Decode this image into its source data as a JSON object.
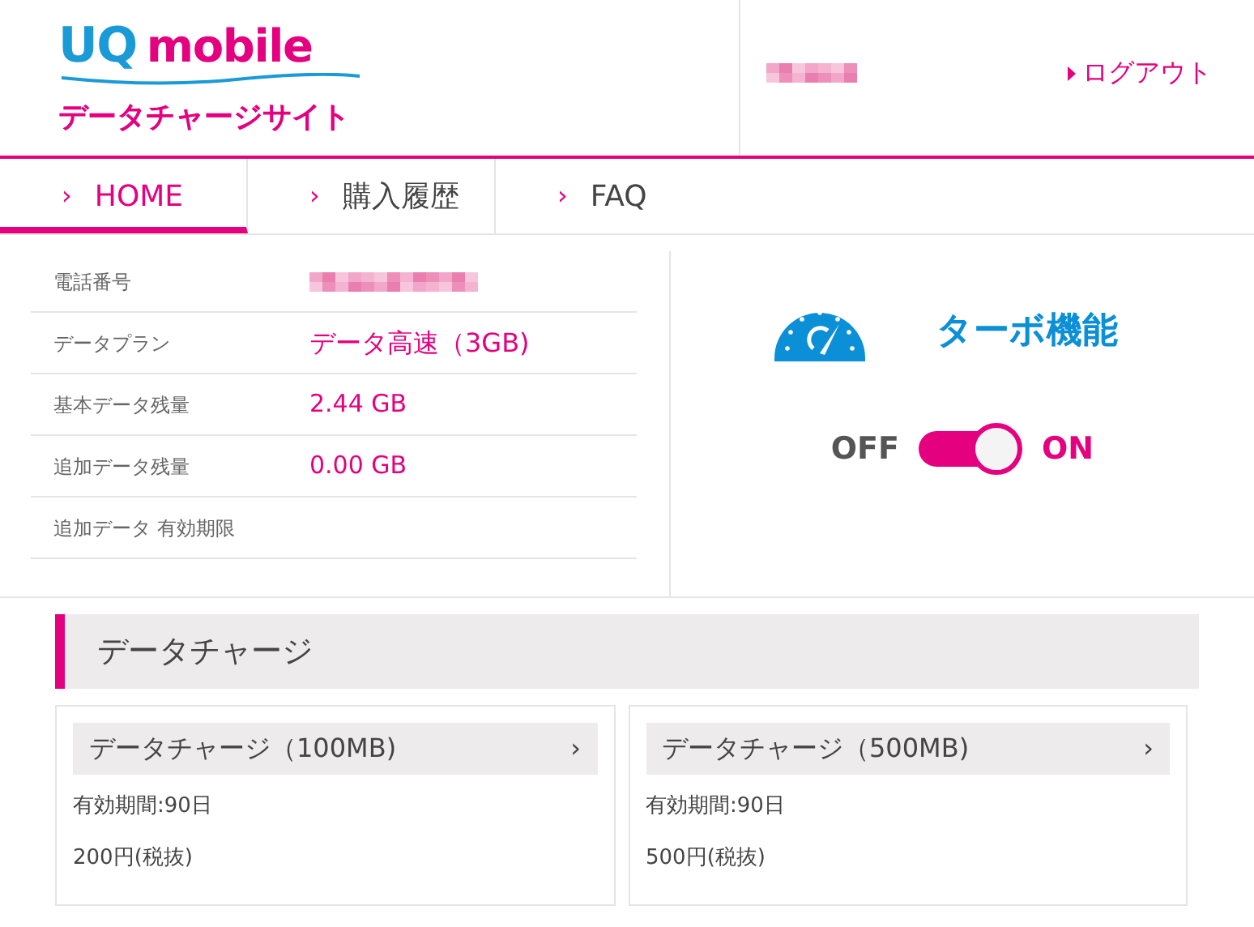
{
  "header": {
    "logo_mark": "UQ",
    "logo_text": "mobile",
    "site_name": "データチャージサイト",
    "logout": "ログアウト"
  },
  "tabs": [
    {
      "arrow": "›",
      "label": "HOME",
      "selected": true
    },
    {
      "arrow": "›",
      "label": "購入履歴",
      "selected": false
    },
    {
      "arrow": "›",
      "label": "FAQ",
      "selected": false
    }
  ],
  "info": [
    {
      "label": "電話番号",
      "kind": "redacted"
    },
    {
      "label": "データプラン",
      "value": "データ高速（3GB)",
      "kind": "text"
    },
    {
      "label": "基本データ残量",
      "value": "2.44 GB",
      "kind": "text"
    },
    {
      "label": "追加データ残量",
      "value": "0.00 GB",
      "kind": "text"
    },
    {
      "label": "追加データ 有効期限",
      "kind": "empty"
    }
  ],
  "turbo": {
    "title": "ターボ機能",
    "off_label": "OFF",
    "on_label": "ON",
    "on": true
  },
  "charge": {
    "title": "データチャージ",
    "options": [
      {
        "name": "データチャージ（100MB)",
        "arrow": "›",
        "validity": "有効期間:90日",
        "price": "200円(税抜)"
      },
      {
        "name": "データチャージ（500MB)",
        "arrow": "›",
        "validity": "有効期間:90日",
        "price": "500円(税抜)"
      }
    ]
  }
}
